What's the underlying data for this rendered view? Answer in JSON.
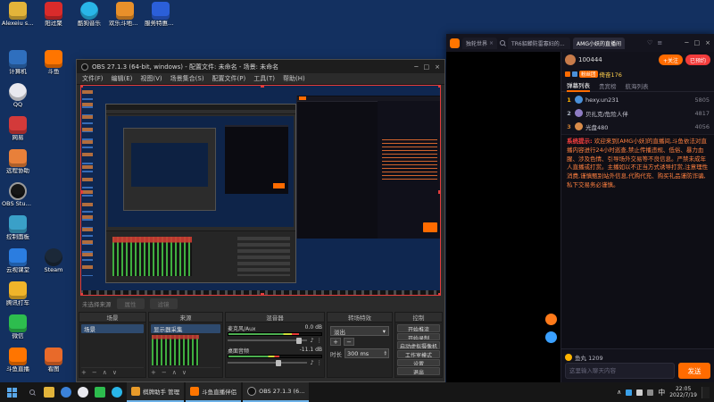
{
  "chrome": {
    "min": "─",
    "max": "□",
    "close": "×"
  },
  "desktop": {
    "top_icons": [
      {
        "label": "Alexeiu sh.."
      },
      {
        "label": "阳过聚"
      },
      {
        "label": "酷狗音乐"
      },
      {
        "label": "欢乐斗地主《"
      },
      {
        "label": "服务特惠官方"
      }
    ],
    "left_icons": [
      {
        "label": "计算机"
      },
      {
        "label": "QQ"
      },
      {
        "label": "网易"
      },
      {
        "label": "远程协助"
      },
      {
        "label": "OBS Studio"
      },
      {
        "label": "控制面板"
      },
      {
        "label": "云视课堂"
      },
      {
        "label": "腾讯打车"
      },
      {
        "label": "微信"
      },
      {
        "label": "斗鱼直播"
      }
    ],
    "side_icons": [
      {
        "label": "斗鱼"
      },
      {
        "label": "Steam"
      },
      {
        "label": "看图"
      }
    ]
  },
  "obs": {
    "title": "OBS 27.1.3 (64-bit, windows) - 配置文件: 未命名 - 场景: 未命名",
    "menu": [
      "文件(F)",
      "编辑(E)",
      "视图(V)",
      "场景集合(S)",
      "配置文件(P)",
      "工具(T)",
      "帮助(H)"
    ],
    "context": {
      "no_source": "未选择来源",
      "properties": "属性",
      "filters": "滤镜"
    },
    "toolbar": {
      "add": "+",
      "remove": "−",
      "up": "∧",
      "down": "∨",
      "caret": "▾",
      "spin": "▴"
    },
    "scenes": {
      "title": "场景",
      "items": [
        "场景"
      ]
    },
    "sources": {
      "title": "来源",
      "items": [
        "显示器采集"
      ]
    },
    "mixer": {
      "title": "混音器",
      "icons": {
        "audio": "♪",
        "more": "⋮"
      },
      "channels": [
        {
          "name": "麦克风/Aux",
          "db": "0.0 dB"
        },
        {
          "name": "桌面音频",
          "db": "-11.1 dB"
        }
      ]
    },
    "transitions": {
      "title": "转场特效",
      "current": "淡出",
      "duration_label": "时长",
      "duration": "300 ms"
    },
    "controls": {
      "title": "控制",
      "buttons": [
        "开始推流",
        "开始录制",
        "启动虚拟摄像机",
        "工作室模式",
        "设置",
        "退出"
      ]
    }
  },
  "douyu": {
    "tabs": [
      {
        "label": "独轮世界"
      },
      {
        "label": "TR6貂蝉防雷寡妇的直播间"
      },
      {
        "label": "AMG小妖的直播间"
      }
    ],
    "icons": {
      "heart": "♡",
      "menu": "≡"
    },
    "header": {
      "viewers": "100444",
      "follow": "+关注",
      "reserved": "已预约",
      "streamer": "倚奋176",
      "fan_badge": "粉丝团"
    },
    "panel_tabs": [
      "弹幕列表",
      "贵宾榜",
      "航海列表"
    ],
    "rank": [
      {
        "no": "1",
        "name": "hexy.un231",
        "value": "5805"
      },
      {
        "no": "2",
        "name": "贝扎克/危险人伴",
        "value": "4817"
      },
      {
        "no": "3",
        "name": "光盘480",
        "value": "4056"
      }
    ],
    "notice": {
      "prefix": "系统提示:",
      "text": "欢迎来到[AMG小妖]的直播间,斗鱼依法对直播内容进行24小时巡查,禁止传播违规、低俗、暴力血腥、涉及色情、引导场外交易等不良信息。严禁未成年人直播或打赏。主播如以不正当方式诱导打赏,注意理性消费,谨慎甄别站外信息,代购代充、购买礼品谨防诈骗,私下交易务必谨慎。"
    },
    "bottom": {
      "fishball": "鱼丸 1209",
      "placeholder": "这里输入聊天内容",
      "send": "发送"
    }
  },
  "taskbar": {
    "tasks": [
      {
        "label": "棋牌助手 管理"
      },
      {
        "label": "斗鱼直播伴侣"
      },
      {
        "label": "OBS 27.1.3 (6..."
      }
    ],
    "tray": {
      "expand": "∧",
      "ime": "中",
      "time": "22:05",
      "date": "2022/7/19"
    }
  }
}
